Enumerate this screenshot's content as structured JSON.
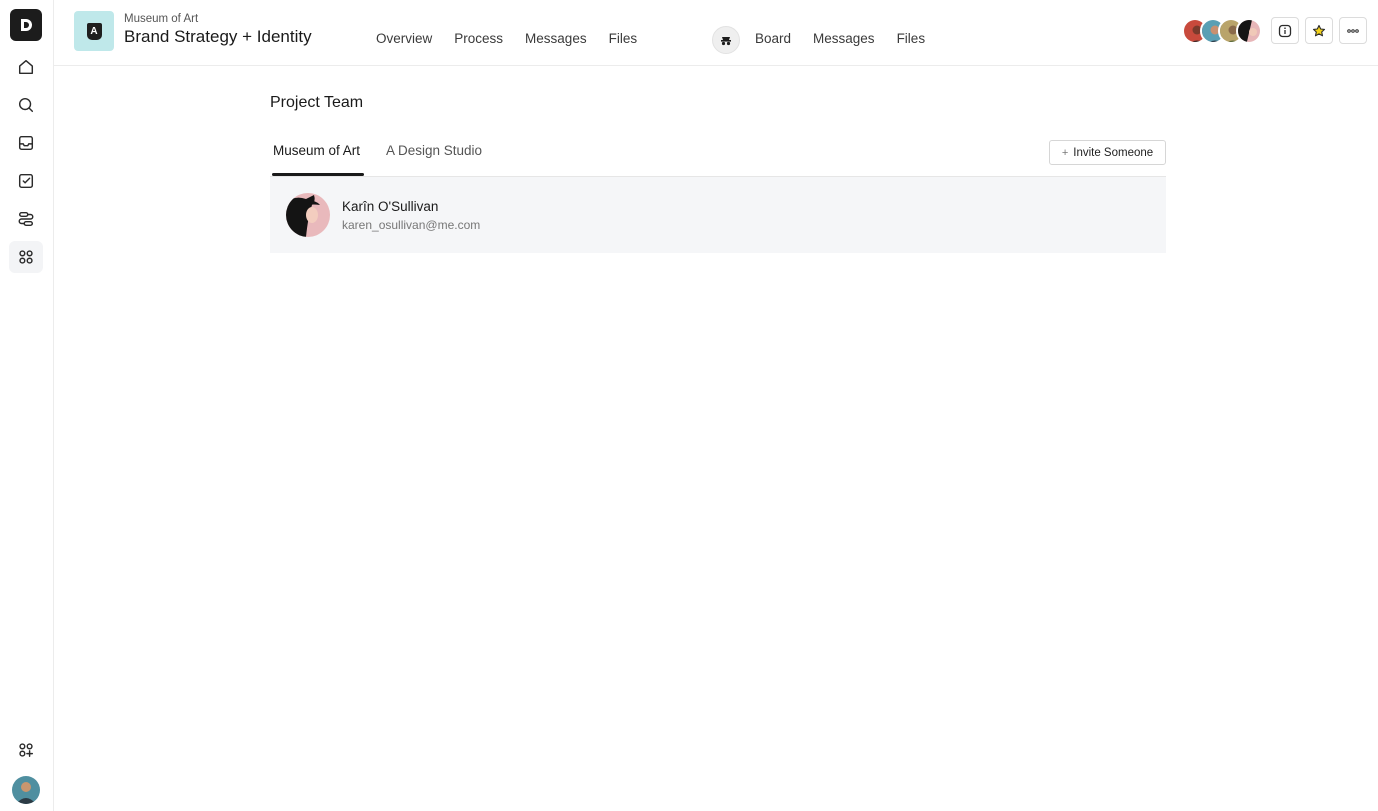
{
  "rail": {
    "logo_letter": "D",
    "items": [
      {
        "name": "home-icon"
      },
      {
        "name": "search-icon"
      },
      {
        "name": "inbox-icon"
      },
      {
        "name": "tasks-icon"
      },
      {
        "name": "flow-icon"
      },
      {
        "name": "apps-icon",
        "active": true
      }
    ],
    "bottom_items": [
      {
        "name": "add-apps-icon"
      }
    ]
  },
  "header": {
    "client": "Museum of Art",
    "title": "Brand Strategy + Identity",
    "project_icon_letter": "A",
    "nav_client": [
      "Overview",
      "Process",
      "Messages",
      "Files"
    ],
    "nav_studio": [
      "Board",
      "Messages",
      "Files"
    ]
  },
  "main": {
    "title": "Project Team",
    "tabs": [
      {
        "label": "Museum of Art",
        "active": true
      },
      {
        "label": "A Design Studio",
        "active": false
      }
    ],
    "invite_label": "Invite Someone",
    "members": [
      {
        "name": "Karîn O'Sullivan",
        "email": "karen_osullivan@me.com"
      }
    ]
  },
  "colors": {
    "accent_teal": "#bfe8ea",
    "row_background": "#f5f6f8",
    "star": "#f2d21b"
  }
}
